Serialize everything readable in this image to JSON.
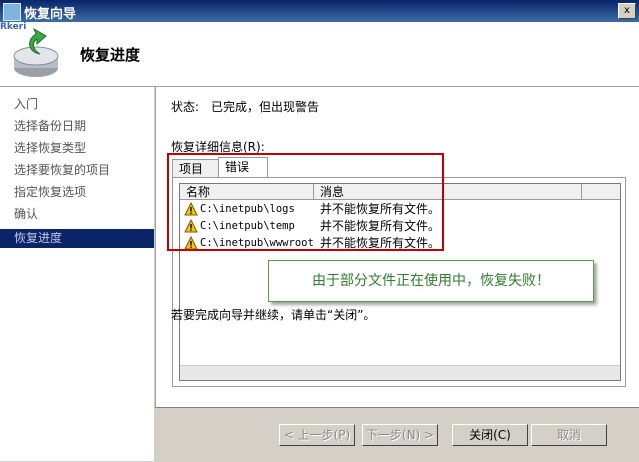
{
  "window": {
    "title": "恢复向导",
    "close_glyph": "x"
  },
  "header": {
    "title": "恢复进度",
    "watermark": "Rkeri"
  },
  "nav": {
    "items": [
      {
        "label": "入门",
        "active": false
      },
      {
        "label": "选择备份日期",
        "active": false
      },
      {
        "label": "选择恢复类型",
        "active": false
      },
      {
        "label": "选择要恢复的项目",
        "active": false
      },
      {
        "label": "指定恢复选项",
        "active": false
      },
      {
        "label": "确认",
        "active": false
      },
      {
        "label": "恢复进度",
        "active": true
      }
    ]
  },
  "status": {
    "label": "状态:",
    "value": "已完成，但出现警告"
  },
  "details": {
    "label": "恢复详细信息(R):",
    "tabs": [
      {
        "label": "项目",
        "active": false
      },
      {
        "label": "错误",
        "active": true
      }
    ],
    "columns": [
      "名称",
      "消息"
    ],
    "rows": [
      {
        "name": "C:\\inetpub\\logs",
        "message": "并不能恢复所有文件。"
      },
      {
        "name": "C:\\inetpub\\temp",
        "message": "并不能恢复所有文件。"
      },
      {
        "name": "C:\\inetpub\\wwwroot",
        "message": "并不能恢复所有文件。"
      }
    ]
  },
  "callout": "由于部分文件正在使用中，恢复失败！",
  "hint": "若要完成向导并继续，请单击“关闭”。",
  "buttons": {
    "prev": "< 上一步(P)",
    "next": "下一步(N) >",
    "close": "关闭(C)",
    "cancel": "取消"
  },
  "colors": {
    "titlebar": "#0a246a",
    "nav_active": "#0a246a",
    "highlight": "#c00000",
    "callout_text": "#2f7d2f"
  }
}
